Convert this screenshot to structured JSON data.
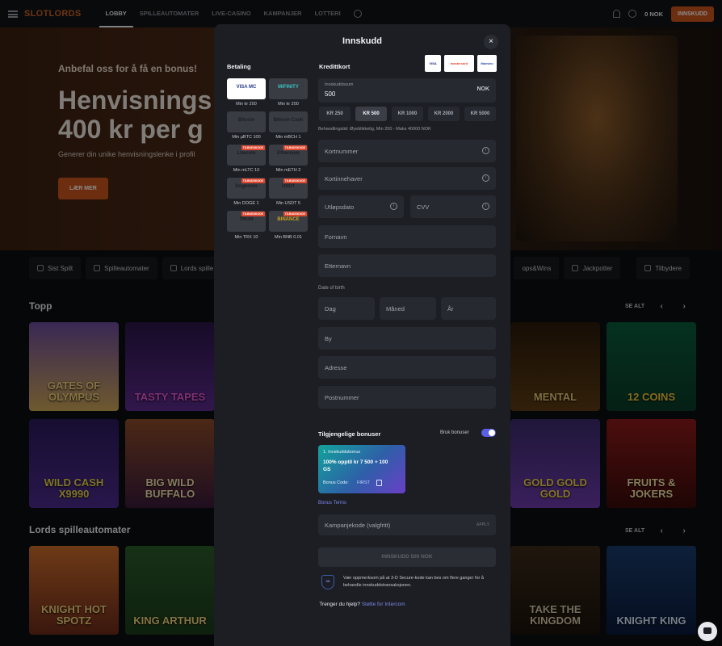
{
  "header": {
    "logo": "SLOTLORDS",
    "nav": [
      "LOBBY",
      "SPILLEAUTOMATER",
      "LIVE-CASINO",
      "KAMPANJER",
      "LOTTERI"
    ],
    "balance": "0 NOK",
    "deposit_label": "INNSKUDD"
  },
  "hero": {
    "subtitle": "Anbefal oss for å få en bonus!",
    "title_line1": "Henvisnings",
    "title_line2": "400 kr per g",
    "description": "Generer din unike henvisningslenke i profil",
    "button": "LÆR MER"
  },
  "categories": [
    "Sist Spilt",
    "Spilleautomater",
    "Lords spille",
    "ops&Wins",
    "Jackpotter",
    "Tilbydere"
  ],
  "sections": {
    "top_title": "Topp",
    "top_see_all": "SE ALT",
    "lords_title": "Lords spilleautomater",
    "lords_see_all": "SE ALT"
  },
  "games": {
    "row1": [
      "GATES OF OLYMPUS",
      "TASTY TAPES",
      "MENTAL",
      "12 COINS"
    ],
    "row2": [
      "WILD CASH X9990",
      "BIG WILD BUFFALO",
      "GOLD GOLD GOLD",
      "FRUITS & JOKERS"
    ],
    "row3": [
      "KNIGHT HOT SPOTZ",
      "KING ARTHUR",
      "TAKE THE KINGDOM",
      "KNIGHT KING"
    ]
  },
  "modal": {
    "title": "Innskudd",
    "close": "×",
    "payment_label": "Betaling",
    "methods": [
      {
        "name": "VISA  MC",
        "min": "Min kr 200",
        "badge": ""
      },
      {
        "name": "MIFINITY",
        "min": "Min kr 200",
        "badge": ""
      },
      {
        "name": "Bitcoin",
        "min": "Min µBTC 100",
        "badge": ""
      },
      {
        "name": "Bitcoin Cash",
        "min": "Min mBCH 1",
        "badge": ""
      },
      {
        "name": "Litecoin",
        "min": "Min mLTC 10",
        "badge": "TILBUDSKODE"
      },
      {
        "name": "Ethereum",
        "min": "Min mETH 2",
        "badge": "TILBUDSKODE"
      },
      {
        "name": "Dogecoin",
        "min": "Min DOGE 1",
        "badge": "TILBUDSKODE"
      },
      {
        "name": "USDT",
        "min": "Min USDT 5",
        "badge": "TILBUDSKODE"
      },
      {
        "name": "TRON",
        "min": "Min TRX 10",
        "badge": "TILBUDSKODE"
      },
      {
        "name": "BINANCE",
        "min": "Min BNB 0.01",
        "badge": "TILBUDSKODE"
      }
    ],
    "card_section_label": "Kredittkort",
    "card_logos": [
      "VISA",
      "mastercard",
      "Maestro"
    ],
    "amount_label": "Innskuddssum",
    "amount_value": "500",
    "currency": "NOK",
    "amount_chips": [
      "KR 250",
      "KR 500",
      "KR 1000",
      "KR 2000",
      "KR 5000"
    ],
    "selected_chip": "KR 500",
    "hint": "Behandlingstid: Øyeblikkelig, Min 200 - Maks 40000 NOK",
    "fields": {
      "card_number": "Kortnummer",
      "card_holder": "Kortinnehaver",
      "expiry": "Utløpsdato",
      "cvv": "CVV",
      "first_name": "Fornavn",
      "last_name": "Etternavn",
      "dob_label": "Date of birth",
      "day": "Dag",
      "month": "Måned",
      "year": "År",
      "city": "By",
      "address": "Adresse",
      "postcode": "Postnummer"
    },
    "bonus_title": "Tilgjengelige bonuser",
    "use_bonus": "Bruk bonuser",
    "bonus_card": {
      "line1": "1. Innskuddsbonus",
      "line2": "100% opptil kr 7 500 + 100 GS",
      "code_label": "Bonus Code:",
      "code_value": "FIRST"
    },
    "bonus_terms": "Bonus Terms",
    "promo_placeholder": "Kampanjekode (valgfritt)",
    "apply": "APPLY",
    "submit": "INNSKUDD 500 NOK",
    "secure_badge": "3D",
    "secure_text": "Vær oppmerksom på at 3-D Secure-kode kan bes om flere ganger for å behandle innskuddstransaksjonen.",
    "help_text": "Trenger du hjelp?",
    "help_link": "Støtte for Intercom"
  },
  "colors": {
    "accent": "#c7521d",
    "modal_bg": "#1c1e24",
    "field_bg": "#272930",
    "link": "#7d86e8",
    "toggle": "#5b5fe6"
  }
}
